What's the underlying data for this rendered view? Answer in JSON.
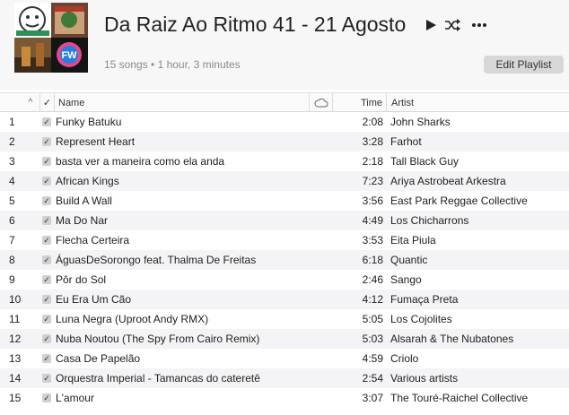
{
  "playlist": {
    "title": "Da Raiz Ao Ritmo 41 - 21 Agosto",
    "summary": "15 songs • 1 hour, 3 minutes",
    "edit_label": "Edit Playlist",
    "art_badge": "FW"
  },
  "columns": {
    "name": "Name",
    "time": "Time",
    "artist": "Artist",
    "check": "✓",
    "sort": "^"
  },
  "icons": {
    "play": "play-icon",
    "shuffle": "shuffle-icon",
    "more": "more-icon",
    "cloud": "cloud-icon"
  },
  "tracks": [
    {
      "num": "1",
      "name": "Funky Batuku",
      "time": "2:08",
      "artist": "John Sharks"
    },
    {
      "num": "2",
      "name": "Represent Heart",
      "time": "3:28",
      "artist": "Farhot"
    },
    {
      "num": "3",
      "name": "basta ver a maneira como ela anda",
      "time": "2:18",
      "artist": "Tall Black Guy"
    },
    {
      "num": "4",
      "name": "African Kings",
      "time": "7:23",
      "artist": "Ariya Astrobeat Arkestra"
    },
    {
      "num": "5",
      "name": "Build A Wall",
      "time": "3:56",
      "artist": "East Park Reggae Collective"
    },
    {
      "num": "6",
      "name": "Ma Do Nar",
      "time": "4:49",
      "artist": "Los Chicharrons"
    },
    {
      "num": "7",
      "name": "Flecha Certeira",
      "time": "3:53",
      "artist": "Eita Piula"
    },
    {
      "num": "8",
      "name": "ÁguasDeSorongo feat. Thalma De Freitas",
      "time": "6:18",
      "artist": "Quantic"
    },
    {
      "num": "9",
      "name": "Pôr do Sol",
      "time": "2:46",
      "artist": "Sango"
    },
    {
      "num": "10",
      "name": "Eu Era Um Cão",
      "time": "4:12",
      "artist": "Fumaça Preta"
    },
    {
      "num": "11",
      "name": "Luna Negra (Uproot Andy RMX)",
      "time": "5:05",
      "artist": "Los Cojolites"
    },
    {
      "num": "12",
      "name": "Nuba Noutou (The Spy From Cairo Remix)",
      "time": "5:03",
      "artist": "Alsarah & The Nubatones"
    },
    {
      "num": "13",
      "name": "Casa De Papelão",
      "time": "4:59",
      "artist": "Criolo"
    },
    {
      "num": "14",
      "name": "Orquestra Imperial - Tamancas do cateretê",
      "time": "2:54",
      "artist": "Various artists"
    },
    {
      "num": "15",
      "name": "L'amour",
      "time": "3:07",
      "artist": "The Touré-Raichel Collective"
    }
  ]
}
